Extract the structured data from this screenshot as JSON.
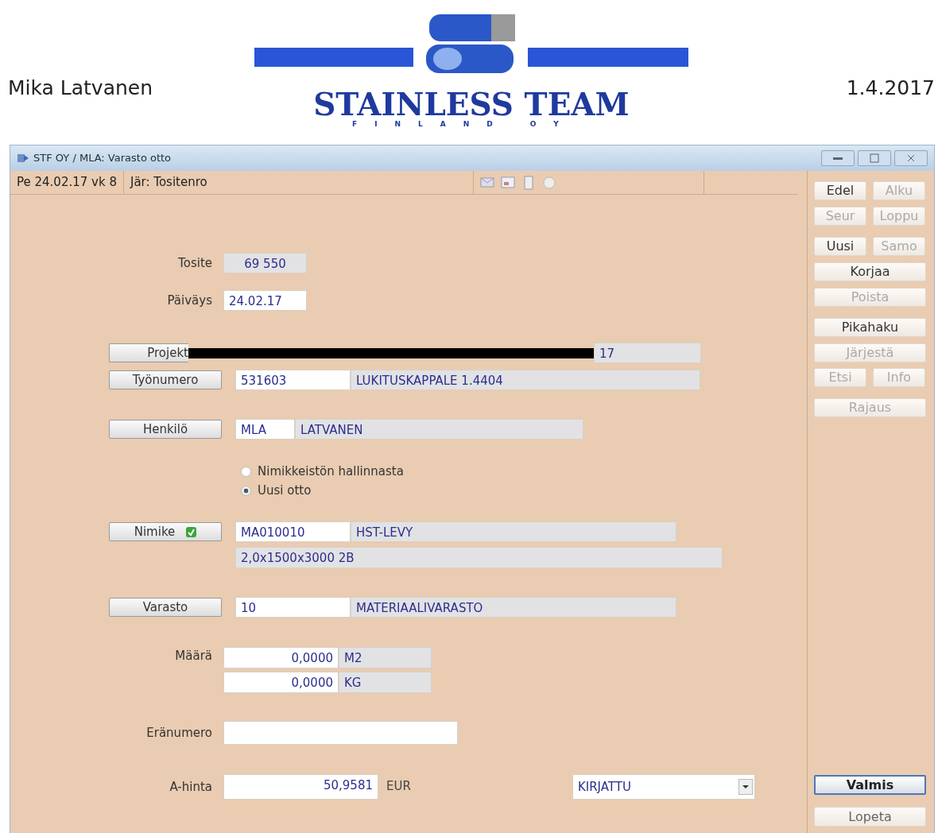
{
  "header": {
    "user": "Mika Latvanen",
    "logo": {
      "name": "STAINLESS TEAM",
      "subtitle": "FINLAND OY"
    },
    "date": "1.4.2017"
  },
  "window": {
    "title": "STF OY / MLA: Varasto otto"
  },
  "toolbar": {
    "date": "Pe 24.02.17 vk  8",
    "sort": "Jär: Tositenro"
  },
  "form": [
    {
      "kind": "text",
      "label": "Tosite",
      "value": "69 550",
      "readonly": true
    },
    {
      "kind": "text",
      "label": "Päiväys",
      "value": "24.02.17",
      "readonly": false
    },
    {
      "kind": "lookup",
      "button": "Projekt",
      "name": "17",
      "redacted": true
    },
    {
      "kind": "lookup",
      "button": "Työnumero",
      "code": "531603",
      "name": "LUKITUSKAPPALE 1.4404"
    },
    {
      "kind": "lookup",
      "button": "Henkilö",
      "code": "MLA",
      "name": "LATVANEN"
    },
    {
      "kind": "radios",
      "options": [
        {
          "label": "Nimikkeistön hallinnasta",
          "selected": false
        },
        {
          "label": "Uusi otto",
          "selected": true
        }
      ]
    },
    {
      "kind": "lookup",
      "button": "Nimike",
      "verified": true,
      "code": "MA010010",
      "name": "HST-LEVY",
      "extra": "2,0x1500x3000 2B"
    },
    {
      "kind": "lookup",
      "button": "Varasto",
      "code": "10",
      "name": "MATERIAALIVARASTO"
    },
    {
      "kind": "quantity",
      "label": "Määrä",
      "lines": [
        {
          "value": "0,0000",
          "unit": "M2"
        },
        {
          "value": "0,0000",
          "unit": "KG"
        }
      ]
    },
    {
      "kind": "text",
      "label": "Eränumero",
      "readonly": false
    },
    {
      "kind": "price",
      "label": "A-hinta",
      "value": "50,9581",
      "currency": "EUR",
      "status": "KIRJATTU"
    }
  ],
  "side_buttons": [
    {
      "row": [
        {
          "label": "Edel",
          "disabled": false
        },
        {
          "label": "Alku",
          "disabled": true
        }
      ]
    },
    {
      "row": [
        {
          "label": "Seur",
          "disabled": true
        },
        {
          "label": "Loppu",
          "disabled": true
        }
      ]
    },
    {
      "row": [
        {
          "label": "Uusi",
          "disabled": false
        },
        {
          "label": "Samo",
          "disabled": true
        }
      ]
    },
    {
      "row": [
        {
          "label": "Korjaa",
          "disabled": false
        }
      ]
    },
    {
      "row": [
        {
          "label": "Poista",
          "disabled": true
        }
      ]
    },
    {
      "row": [
        {
          "label": "Pikahaku",
          "disabled": false
        }
      ]
    },
    {
      "row": [
        {
          "label": "Järjestä",
          "disabled": true
        }
      ]
    },
    {
      "row": [
        {
          "label": "Etsi",
          "disabled": true
        },
        {
          "label": "Info",
          "disabled": true
        }
      ]
    },
    {
      "row": [
        {
          "label": "Rajaus",
          "disabled": true
        }
      ]
    }
  ],
  "bottom_buttons": [
    {
      "label": "Valmis",
      "default": true
    },
    {
      "label": "Lopeta",
      "default": false
    }
  ]
}
